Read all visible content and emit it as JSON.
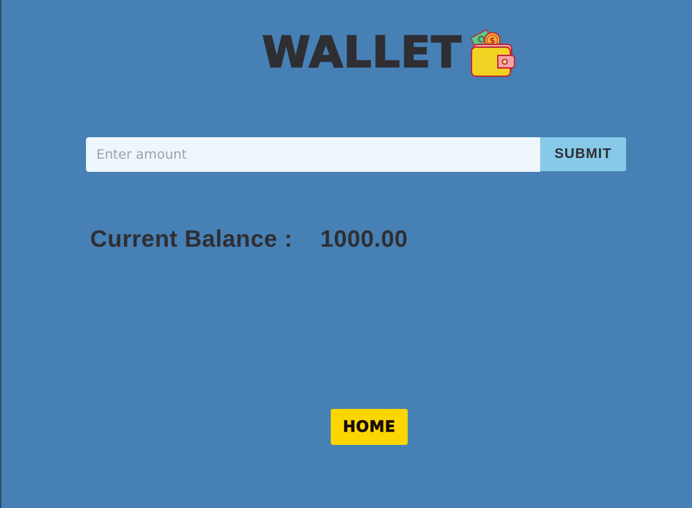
{
  "header": {
    "title": "WALLET",
    "icon": "wallet-with-money-icon"
  },
  "form": {
    "amount_placeholder": "Enter amount",
    "amount_value": "",
    "submit_label": "SUBMIT"
  },
  "balance": {
    "label": "Current Balance :",
    "value": "1000.00"
  },
  "nav": {
    "home_label": "HOME"
  },
  "colors": {
    "background": "#4680b4",
    "text": "#2f2f33",
    "input_bg": "#eff6fd",
    "submit_bg": "#86c9e8",
    "home_bg": "#fdd600"
  }
}
